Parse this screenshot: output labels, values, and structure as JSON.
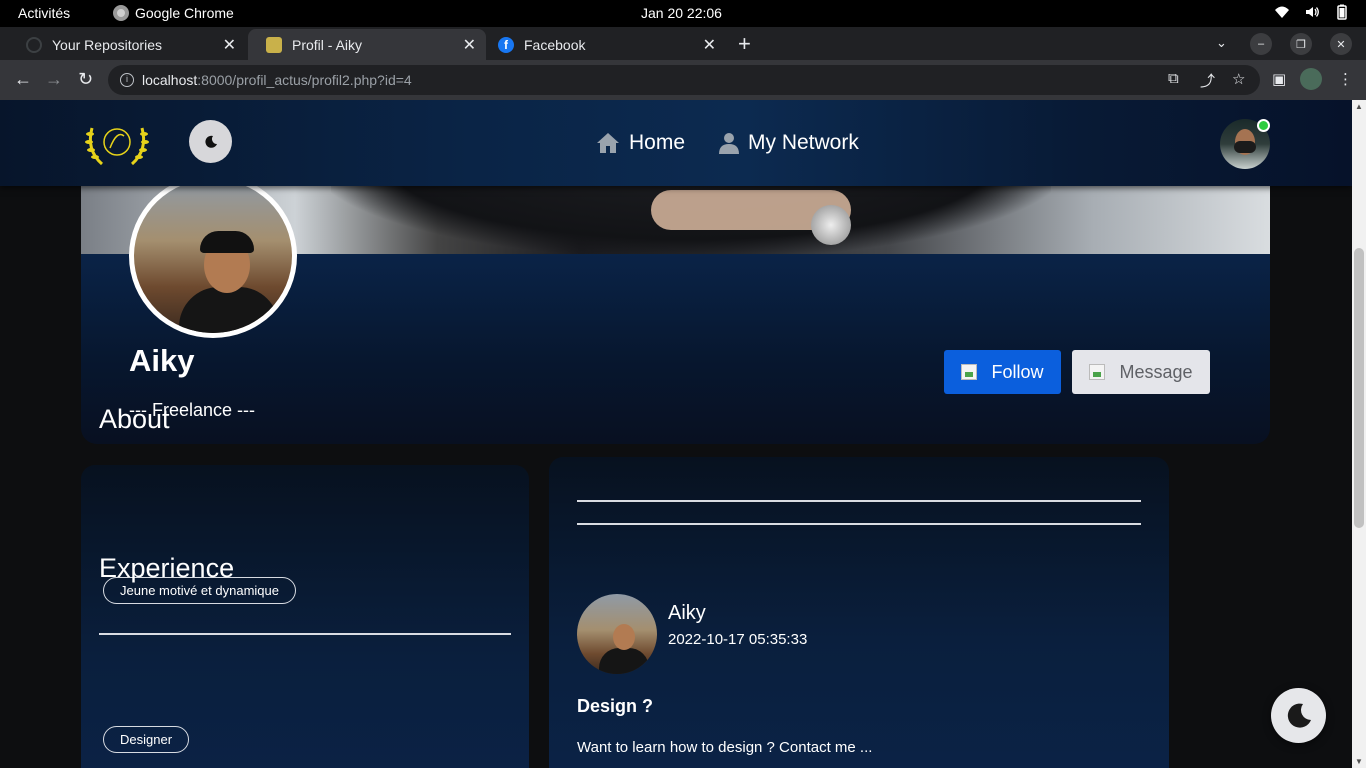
{
  "os": {
    "activities": "Activités",
    "app_name": "Google Chrome",
    "clock": "Jan 20  22:06"
  },
  "browser": {
    "tabs": [
      {
        "title": "Your Repositories",
        "active": false
      },
      {
        "title": "Profil - Aiky",
        "active": true
      },
      {
        "title": "Facebook",
        "active": false
      }
    ],
    "url_host": "localhost",
    "url_path": ":8000/profil_actus/profil2.php?id=4"
  },
  "header": {
    "nav": [
      {
        "label": "Home",
        "icon": "home-icon"
      },
      {
        "label": "My Network",
        "icon": "user-icon"
      }
    ]
  },
  "profile": {
    "name": "Aiky",
    "subtitle": "--- Freelance ---",
    "follow_label": "Follow",
    "message_label": "Message"
  },
  "about": {
    "title": "About",
    "tag": "Jeune motivé et dynamique",
    "experience_title": "Experience",
    "experience_tag": "Designer"
  },
  "post": {
    "author": "Aiky",
    "date": "2022-10-17 05:35:33",
    "title": "Design ?",
    "body": "Want to learn how to design ? Contact me ..."
  },
  "colors": {
    "accent_blue": "#0b5fdd",
    "header_navy": "#0a2446",
    "online_green": "#2ecc40"
  }
}
